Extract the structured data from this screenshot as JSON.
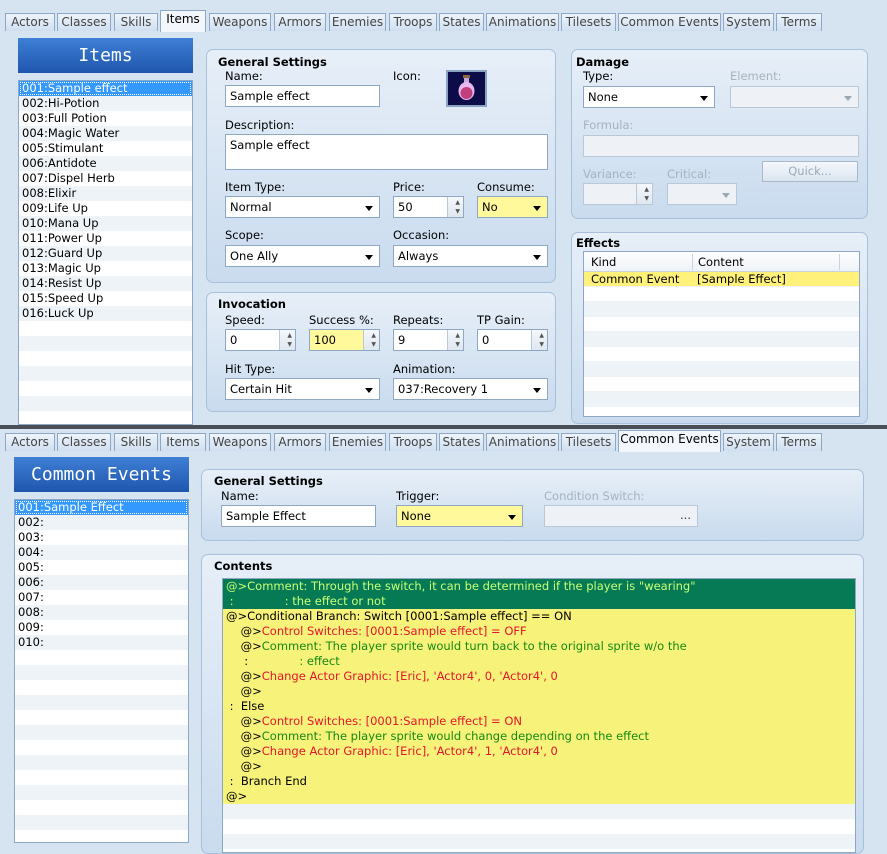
{
  "top": {
    "tabs": [
      "Actors",
      "Classes",
      "Skills",
      "Items",
      "Weapons",
      "Armors",
      "Enemies",
      "Troops",
      "States",
      "Animations",
      "Tilesets",
      "Common Events",
      "System",
      "Terms"
    ],
    "list_title": "Items",
    "list_items": [
      "001:Sample effect",
      "002:Hi-Potion",
      "003:Full Potion",
      "004:Magic Water",
      "005:Stimulant",
      "006:Antidote",
      "007:Dispel Herb",
      "008:Elixir",
      "009:Life Up",
      "010:Mana Up",
      "011:Power Up",
      "012:Guard Up",
      "013:Magic Up",
      "014:Resist Up",
      "015:Speed Up",
      "016:Luck Up"
    ],
    "general": {
      "title": "General Settings",
      "name_label": "Name:",
      "name_value": "Sample effect",
      "icon_label": "Icon:",
      "icon": "potion-icon",
      "desc_label": "Description:",
      "desc_value": "Sample effect",
      "item_type_label": "Item Type:",
      "item_type_value": "Normal",
      "price_label": "Price:",
      "price_value": "50",
      "consume_label": "Consume:",
      "consume_value": "No",
      "scope_label": "Scope:",
      "scope_value": "One Ally",
      "occasion_label": "Occasion:",
      "occasion_value": "Always"
    },
    "invocation": {
      "title": "Invocation",
      "speed_label": "Speed:",
      "speed_value": "0",
      "success_label": "Success %:",
      "success_value": "100",
      "repeats_label": "Repeats:",
      "repeats_value": "9",
      "tp_label": "TP Gain:",
      "tp_value": "0",
      "hit_label": "Hit Type:",
      "hit_value": "Certain Hit",
      "anim_label": "Animation:",
      "anim_value": "037:Recovery 1"
    },
    "damage": {
      "title": "Damage",
      "type_label": "Type:",
      "type_value": "None",
      "element_label": "Element:",
      "formula_label": "Formula:",
      "variance_label": "Variance:",
      "critical_label": "Critical:",
      "quick_label": "Quick..."
    },
    "effects": {
      "title": "Effects",
      "col_kind": "Kind",
      "col_content": "Content",
      "rows": [
        {
          "kind": "Common Event",
          "content": "[Sample Effect]"
        }
      ]
    }
  },
  "bottom": {
    "tabs": [
      "Actors",
      "Classes",
      "Skills",
      "Items",
      "Weapons",
      "Armors",
      "Enemies",
      "Troops",
      "States",
      "Animations",
      "Tilesets",
      "Common Events",
      "System",
      "Terms"
    ],
    "list_title": "Common Events",
    "list_items": [
      "001:Sample Effect",
      "002:",
      "003:",
      "004:",
      "005:",
      "006:",
      "007:",
      "008:",
      "009:",
      "010:"
    ],
    "general": {
      "title": "General Settings",
      "name_label": "Name:",
      "name_value": "Sample Effect",
      "trigger_label": "Trigger:",
      "trigger_value": "None",
      "cond_label": "Condition Switch:",
      "cond_button": "..."
    },
    "contents": {
      "title": "Contents",
      "lines": [
        {
          "prefix": "@>",
          "text": "Comment: Through the switch, it can be determined if the player is \"wearing\"",
          "style": "comment"
        },
        {
          "prefix": " :",
          "text": "              : the effect or not",
          "style": "comment"
        },
        {
          "prefix": "@>",
          "text": "Conditional Branch: Switch [0001:Sample effect] == ON",
          "style": "plain"
        },
        {
          "prefix": "    @>",
          "text": "Control Switches: [0001:Sample effect] = OFF",
          "style": "red"
        },
        {
          "prefix": "    @>",
          "text": "Comment: The player sprite would turn back to the original sprite w/o the",
          "style": "green"
        },
        {
          "prefix": "     :",
          "text": "              : effect",
          "style": "green"
        },
        {
          "prefix": "    @>",
          "text": "Change Actor Graphic: [Eric], 'Actor4', 0, 'Actor4', 0",
          "style": "red"
        },
        {
          "prefix": "    @>",
          "text": "",
          "style": "plain"
        },
        {
          "prefix": " :  ",
          "text": "Else",
          "style": "plain"
        },
        {
          "prefix": "    @>",
          "text": "Control Switches: [0001:Sample effect] = ON",
          "style": "red"
        },
        {
          "prefix": "    @>",
          "text": "Comment: The player sprite would change depending on the effect",
          "style": "green"
        },
        {
          "prefix": "    @>",
          "text": "Change Actor Graphic: [Eric], 'Actor4', 1, 'Actor4', 0",
          "style": "red"
        },
        {
          "prefix": "    @>",
          "text": "",
          "style": "plain"
        },
        {
          "prefix": " :  ",
          "text": "Branch End",
          "style": "plain"
        },
        {
          "prefix": "@>",
          "text": "",
          "style": "plain"
        }
      ]
    }
  },
  "colors": {
    "selection": "#3399ff",
    "highlight": "#fff99c",
    "comment_bg": "#067a55",
    "code_bg": "#f7f27a",
    "red_text": "#e5162d",
    "green_text": "#148a14"
  }
}
